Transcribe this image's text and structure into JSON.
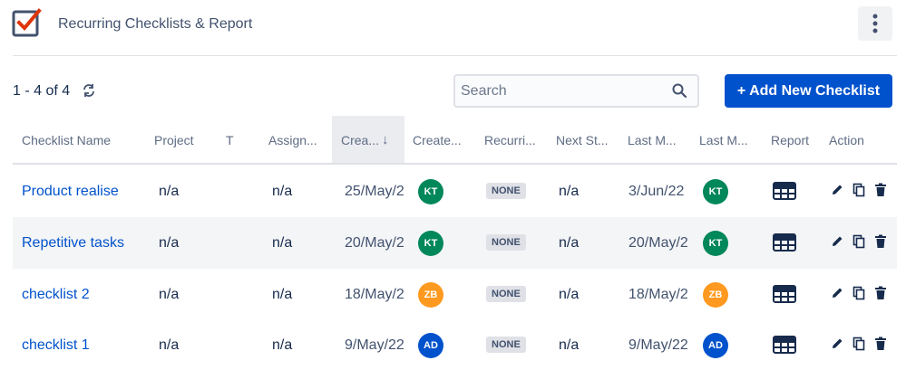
{
  "header": {
    "title": "Recurring Checklists & Report",
    "logo_icon": "checklist-logo-icon",
    "menu_icon": "more-vertical-icon"
  },
  "toolbar": {
    "count": "1 - 4 of 4",
    "refresh_icon": "refresh-icon",
    "search_placeholder": "Search",
    "search_value": "",
    "add_button": "+ Add New Checklist"
  },
  "table": {
    "columns": [
      "Checklist Name",
      "Project",
      "T",
      "Assign...",
      "Crea...",
      "Create...",
      "Recurri...",
      "Next St...",
      "Last M...",
      "Last M...",
      "Report",
      "Action"
    ],
    "sort_indicator": "↓",
    "rows": [
      {
        "name": "Product realise",
        "project": "n/a",
        "assignee": "n/a",
        "created": "25/May/2",
        "creator": "KT",
        "creator_color": "#00875a",
        "recurring": "NONE",
        "next": "n/a",
        "last_modified": "3/Jun/22",
        "modifier": "KT",
        "modifier_color": "#00875a"
      },
      {
        "name": "Repetitive tasks",
        "project": "n/a",
        "assignee": "n/a",
        "created": "20/May/2",
        "creator": "KT",
        "creator_color": "#00875a",
        "recurring": "NONE",
        "next": "n/a",
        "last_modified": "20/May/2",
        "modifier": "KT",
        "modifier_color": "#00875a"
      },
      {
        "name": "checklist 2",
        "project": "n/a",
        "assignee": "n/a",
        "created": "18/May/2",
        "creator": "ZB",
        "creator_color": "#ff991f",
        "recurring": "NONE",
        "next": "n/a",
        "last_modified": "18/May/2",
        "modifier": "ZB",
        "modifier_color": "#ff991f"
      },
      {
        "name": "checklist 1",
        "project": "n/a",
        "assignee": "n/a",
        "created": "9/May/22",
        "creator": "AD",
        "creator_color": "#0052cc",
        "recurring": "NONE",
        "next": "n/a",
        "last_modified": "9/May/22",
        "modifier": "AD",
        "modifier_color": "#0052cc"
      }
    ]
  },
  "colors": {
    "primary": "#0052cc",
    "header_text": "#5e6c84",
    "row_alt": "#f4f5f7",
    "logo_red": "#de350b",
    "logo_gray": "#42526e"
  }
}
